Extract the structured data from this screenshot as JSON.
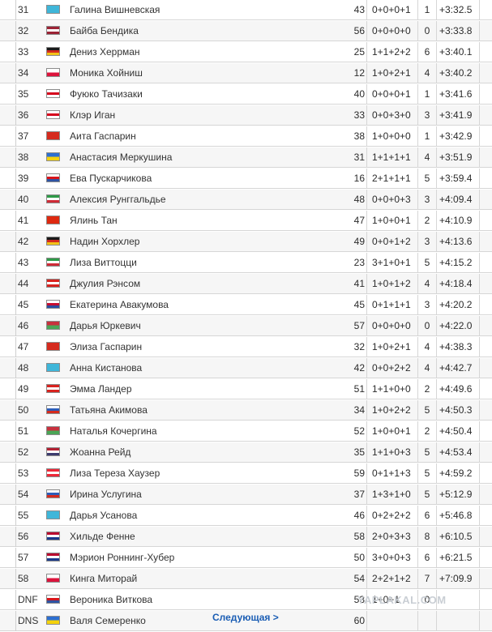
{
  "results": [
    {
      "rank": "31",
      "flag": "kaz",
      "name": "Галина Вишневская",
      "bib": "43",
      "shooting": "0+0+0+1",
      "penalties": "1",
      "time": "+3:32.5"
    },
    {
      "rank": "32",
      "flag": "lat",
      "name": "Байба Бендика",
      "bib": "56",
      "shooting": "0+0+0+0",
      "penalties": "0",
      "time": "+3:33.8"
    },
    {
      "rank": "33",
      "flag": "ger",
      "name": "Дениз Херрман",
      "bib": "25",
      "shooting": "1+1+2+2",
      "penalties": "6",
      "time": "+3:40.1"
    },
    {
      "rank": "34",
      "flag": "pol",
      "name": "Моника Хойниш",
      "bib": "12",
      "shooting": "1+0+2+1",
      "penalties": "4",
      "time": "+3:40.2"
    },
    {
      "rank": "35",
      "flag": "jpn",
      "name": "Фуюко Тачизаки",
      "bib": "40",
      "shooting": "0+0+0+1",
      "penalties": "1",
      "time": "+3:41.6"
    },
    {
      "rank": "36",
      "flag": "jpn",
      "name": "Клэр Иган",
      "bib": "33",
      "shooting": "0+0+3+0",
      "penalties": "3",
      "time": "+3:41.9"
    },
    {
      "rank": "37",
      "flag": "sui",
      "name": "Аита Гаспарин",
      "bib": "38",
      "shooting": "1+0+0+0",
      "penalties": "1",
      "time": "+3:42.9"
    },
    {
      "rank": "38",
      "flag": "ukr",
      "name": "Анастасия Меркушина",
      "bib": "31",
      "shooting": "1+1+1+1",
      "penalties": "4",
      "time": "+3:51.9"
    },
    {
      "rank": "39",
      "flag": "cze",
      "name": "Ева Пускарчикова",
      "bib": "16",
      "shooting": "2+1+1+1",
      "penalties": "5",
      "time": "+3:59.4"
    },
    {
      "rank": "40",
      "flag": "ita",
      "name": "Алексия Рунггальдье",
      "bib": "48",
      "shooting": "0+0+0+3",
      "penalties": "3",
      "time": "+4:09.4"
    },
    {
      "rank": "41",
      "flag": "chn",
      "name": "Ялинь Тан",
      "bib": "47",
      "shooting": "1+0+0+1",
      "penalties": "2",
      "time": "+4:10.9"
    },
    {
      "rank": "42",
      "flag": "ger",
      "name": "Надин Хорхлер",
      "bib": "49",
      "shooting": "0+0+1+2",
      "penalties": "3",
      "time": "+4:13.6"
    },
    {
      "rank": "43",
      "flag": "ita",
      "name": "Лиза Виттоцци",
      "bib": "23",
      "shooting": "3+1+0+1",
      "penalties": "5",
      "time": "+4:15.2"
    },
    {
      "rank": "44",
      "flag": "can",
      "name": "Джулия Рэнсом",
      "bib": "41",
      "shooting": "1+0+1+2",
      "penalties": "4",
      "time": "+4:18.4"
    },
    {
      "rank": "45",
      "flag": "kor",
      "name": "Екатерина Авакумова",
      "bib": "45",
      "shooting": "0+1+1+1",
      "penalties": "3",
      "time": "+4:20.2"
    },
    {
      "rank": "46",
      "flag": "blr",
      "name": "Дарья Юркевич",
      "bib": "57",
      "shooting": "0+0+0+0",
      "penalties": "0",
      "time": "+4:22.0"
    },
    {
      "rank": "47",
      "flag": "sui",
      "name": "Элиза Гаспарин",
      "bib": "32",
      "shooting": "1+0+2+1",
      "penalties": "4",
      "time": "+4:38.3"
    },
    {
      "rank": "48",
      "flag": "kaz",
      "name": "Анна Кистанова",
      "bib": "42",
      "shooting": "0+0+2+2",
      "penalties": "4",
      "time": "+4:42.7"
    },
    {
      "rank": "49",
      "flag": "can",
      "name": "Эмма Ландер",
      "bib": "51",
      "shooting": "1+1+0+0",
      "penalties": "2",
      "time": "+4:49.6"
    },
    {
      "rank": "50",
      "flag": "rus",
      "name": "Татьяна Акимова",
      "bib": "34",
      "shooting": "1+0+2+2",
      "penalties": "5",
      "time": "+4:50.3"
    },
    {
      "rank": "51",
      "flag": "blr",
      "name": "Наталья Кочергина",
      "bib": "52",
      "shooting": "1+0+0+1",
      "penalties": "2",
      "time": "+4:50.4"
    },
    {
      "rank": "52",
      "flag": "usa",
      "name": "Жоанна Рейд",
      "bib": "35",
      "shooting": "1+1+0+3",
      "penalties": "5",
      "time": "+4:53.4"
    },
    {
      "rank": "53",
      "flag": "aut",
      "name": "Лиза Тереза Хаузер",
      "bib": "59",
      "shooting": "0+1+1+3",
      "penalties": "5",
      "time": "+4:59.2"
    },
    {
      "rank": "54",
      "flag": "rus",
      "name": "Ирина Услугина",
      "bib": "37",
      "shooting": "1+3+1+0",
      "penalties": "5",
      "time": "+5:12.9"
    },
    {
      "rank": "55",
      "flag": "kaz",
      "name": "Дарья Усанова",
      "bib": "46",
      "shooting": "0+2+2+2",
      "penalties": "6",
      "time": "+5:46.8"
    },
    {
      "rank": "56",
      "flag": "nor",
      "name": "Хильде Фенне",
      "bib": "58",
      "shooting": "2+0+3+3",
      "penalties": "8",
      "time": "+6:10.5"
    },
    {
      "rank": "57",
      "flag": "nor",
      "name": "Мэрион Роннинг-Хубер",
      "bib": "50",
      "shooting": "3+0+0+3",
      "penalties": "6",
      "time": "+6:21.5"
    },
    {
      "rank": "58",
      "flag": "pol",
      "name": "Кинга Миторай",
      "bib": "54",
      "shooting": "2+2+1+2",
      "penalties": "7",
      "time": "+7:09.9"
    },
    {
      "rank": "DNF",
      "flag": "cze",
      "name": "Вероника Виткова",
      "bib": "53",
      "shooting": "1+0+1",
      "penalties": "0",
      "time": ""
    },
    {
      "rank": "DNS",
      "flag": "ukr",
      "name": "Валя Семеренко",
      "bib": "60",
      "shooting": "",
      "penalties": "",
      "time": ""
    }
  ],
  "pager": {
    "next_label": "Следующая >"
  },
  "watermark": "YAPLAKAL.COM",
  "flag_colors": {
    "kaz": [
      "#3fb6d9",
      "#3fb6d9"
    ],
    "lat": [
      "#9b2335",
      "#ffffff",
      "#9b2335"
    ],
    "ger": [
      "#1a1a1a",
      "#d32a1e",
      "#f2c318"
    ],
    "pol": [
      "#ffffff",
      "#dc143c"
    ],
    "jpn": [
      "#ffffff",
      "#d6001c",
      "#ffffff"
    ],
    "sui": [
      "#d52b1e",
      "#d52b1e"
    ],
    "ukr": [
      "#2d6fd1",
      "#f5d20c"
    ],
    "cze": [
      "#ffffff",
      "#d7141a",
      "#2f54a3"
    ],
    "ita": [
      "#2e9a48",
      "#ffffff",
      "#cf2b37"
    ],
    "chn": [
      "#de2910",
      "#de2910"
    ],
    "can": [
      "#d8231f",
      "#ffffff",
      "#d8231f"
    ],
    "kor": [
      "#ffffff",
      "#c60c30",
      "#2a4ea0"
    ],
    "blr": [
      "#c8313e",
      "#4aa657"
    ],
    "rus": [
      "#ffffff",
      "#2d5cb8",
      "#d52b1e"
    ],
    "usa": [
      "#b22234",
      "#ffffff",
      "#3c3b6e"
    ],
    "aut": [
      "#ed2939",
      "#ffffff",
      "#ed2939"
    ],
    "nor": [
      "#ba0c2f",
      "#ffffff",
      "#1b3a8b"
    ]
  }
}
